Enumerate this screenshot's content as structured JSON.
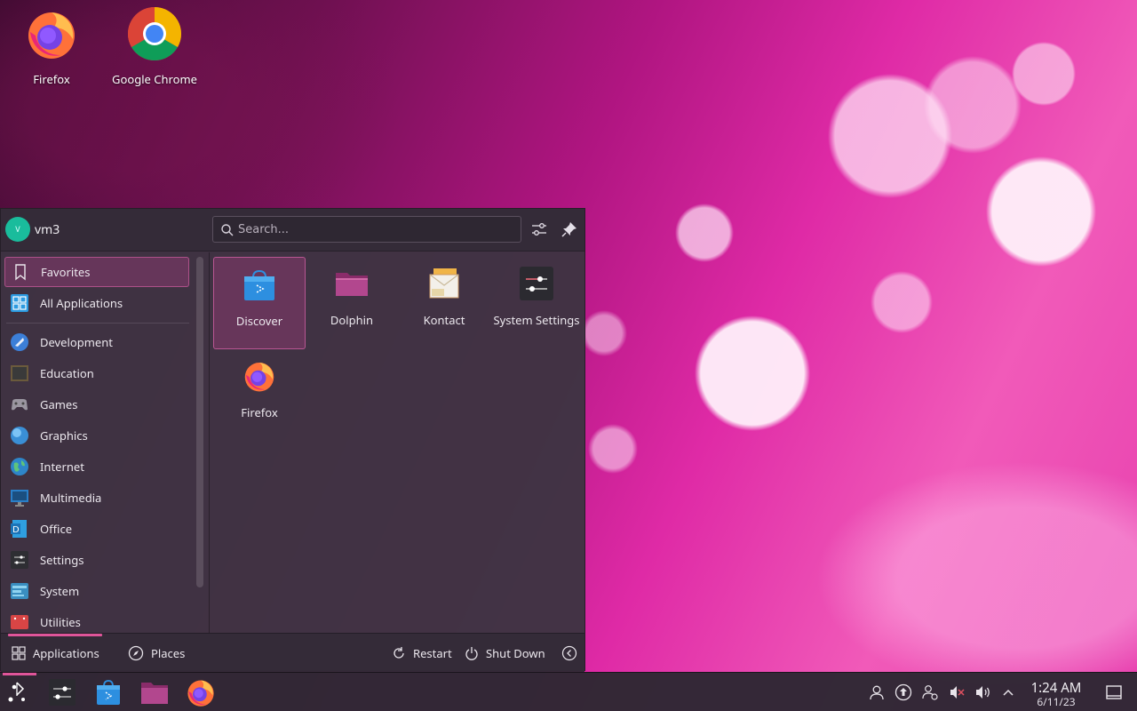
{
  "desktop": {
    "icons": [
      {
        "label": "Firefox",
        "icon": "firefox-icon"
      },
      {
        "label": "Google Chrome",
        "icon": "chrome-icon"
      }
    ]
  },
  "launcher": {
    "user": {
      "name": "vm3",
      "avatar_letter": "V"
    },
    "search": {
      "placeholder": "Search..."
    },
    "categories": [
      {
        "label": "Favorites",
        "icon": "bookmark-icon",
        "selected": true
      },
      {
        "label": "All Applications",
        "icon": "grid-icon"
      },
      {
        "label": "Development",
        "icon": "development-icon"
      },
      {
        "label": "Education",
        "icon": "education-icon"
      },
      {
        "label": "Games",
        "icon": "gamepad-icon"
      },
      {
        "label": "Graphics",
        "icon": "graphics-icon"
      },
      {
        "label": "Internet",
        "icon": "globe-icon"
      },
      {
        "label": "Multimedia",
        "icon": "multimedia-icon"
      },
      {
        "label": "Office",
        "icon": "office-icon"
      },
      {
        "label": "Settings",
        "icon": "settings-icon"
      },
      {
        "label": "System",
        "icon": "system-icon"
      },
      {
        "label": "Utilities",
        "icon": "utilities-icon"
      }
    ],
    "apps": [
      {
        "label": "Discover",
        "icon": "discover-icon",
        "selected": true
      },
      {
        "label": "Dolphin",
        "icon": "dolphin-folder-icon"
      },
      {
        "label": "Kontact",
        "icon": "kontact-icon"
      },
      {
        "label": "System Settings",
        "icon": "system-settings-icon"
      },
      {
        "label": "Firefox",
        "icon": "firefox-icon"
      }
    ],
    "footer": {
      "applications_label": "Applications",
      "places_label": "Places",
      "restart_label": "Restart",
      "shutdown_label": "Shut Down"
    }
  },
  "taskbar": {
    "pinned": [
      "kickoff-icon",
      "system-settings-icon",
      "discover-icon",
      "dolphin-folder-icon",
      "firefox-icon"
    ],
    "tray": [
      "user-icon",
      "update-icon",
      "network-icon",
      "mute-icon",
      "volume-icon",
      "expand-icon"
    ],
    "clock": {
      "time": "1:24 AM",
      "date": "6/11/23"
    },
    "accent": "#e0559a"
  }
}
